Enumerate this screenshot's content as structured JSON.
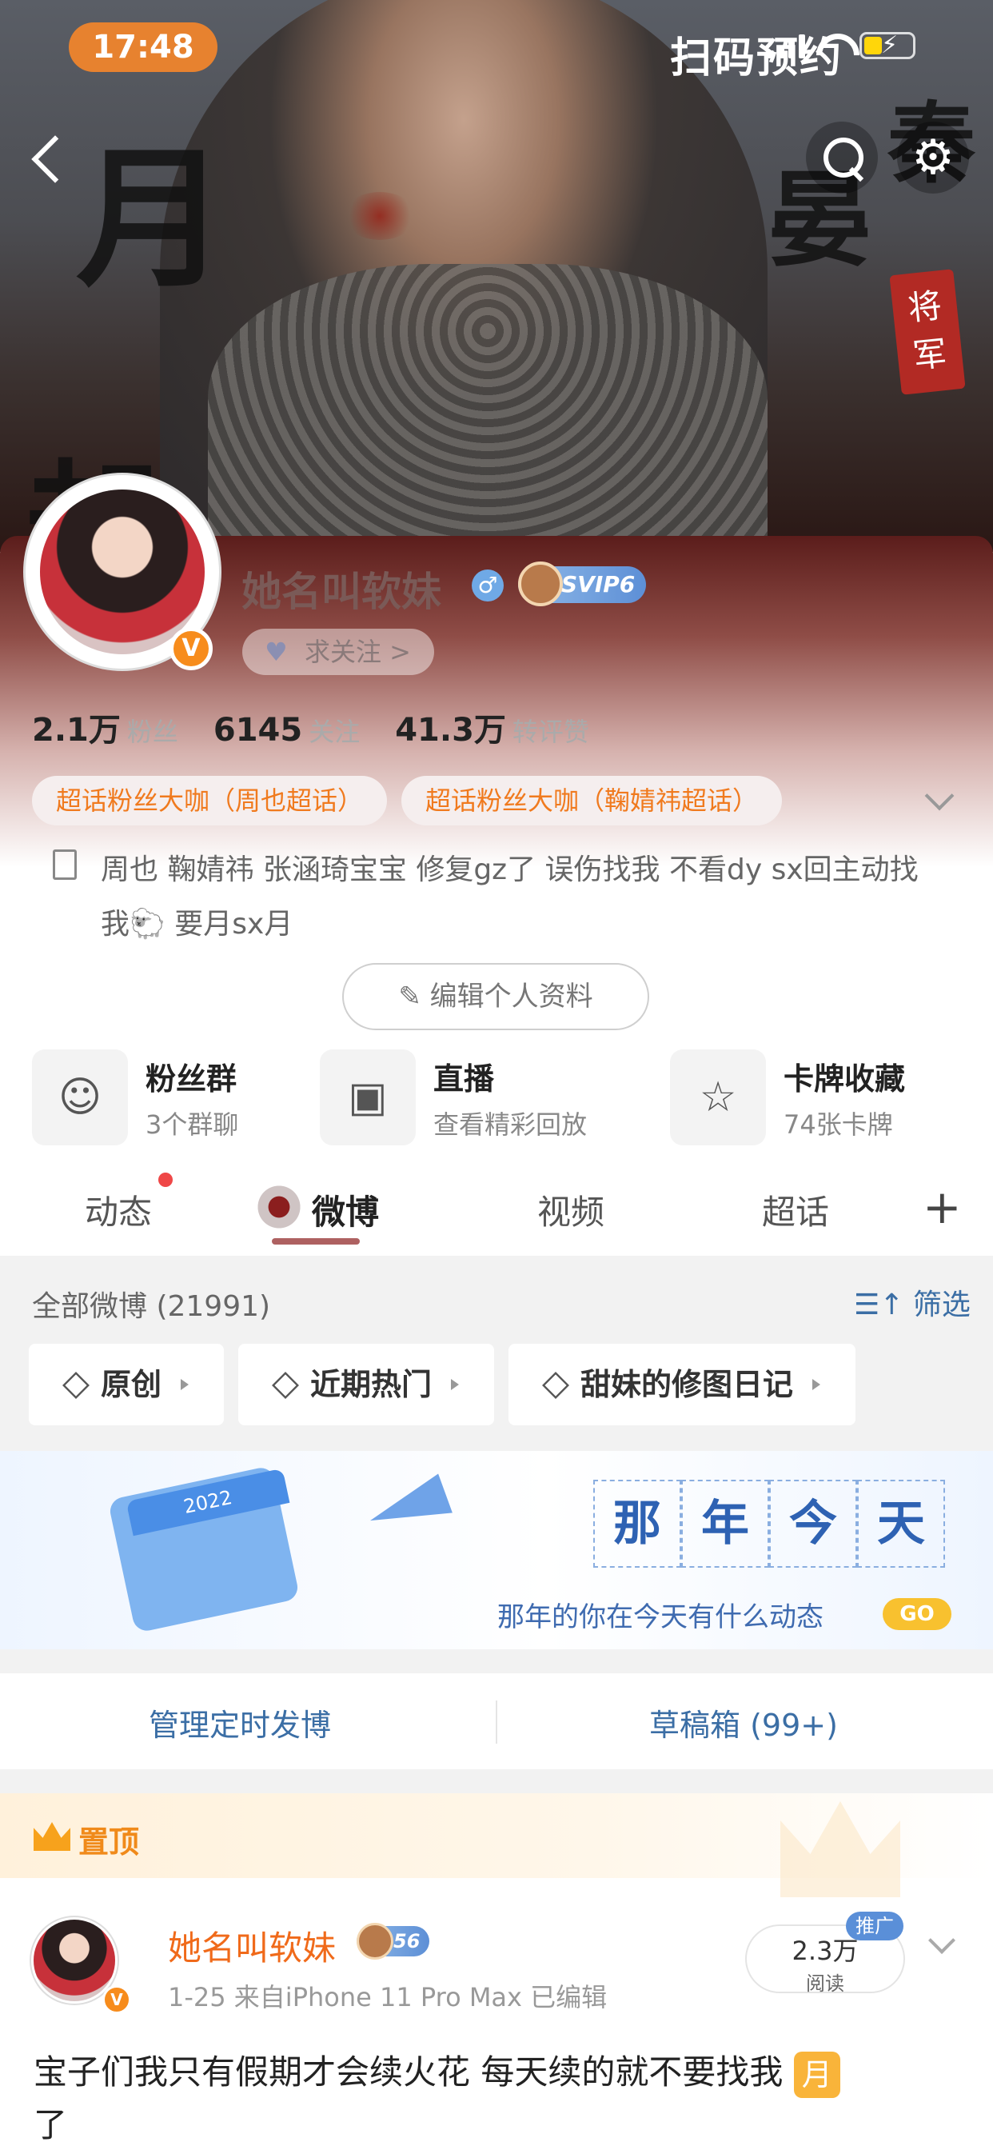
{
  "status_bar": {
    "time": "17:48"
  },
  "hero": {
    "scan_text": "扫码预约",
    "calligraphy": [
      "月",
      "秦",
      "晏",
      "却"
    ],
    "seal_text": "将军"
  },
  "profile": {
    "username": "她名叫软妹",
    "gender_symbol": "♂",
    "svip_label": "SVIP6",
    "verified_badge": "V",
    "follow_label": "求关注 >",
    "stats": [
      {
        "value": "2.1万",
        "label": "粉丝"
      },
      {
        "value": "6145",
        "label": "关注"
      },
      {
        "value": "41.3万",
        "label": "转评赞"
      }
    ],
    "tags": [
      "超话粉丝大咖（周也超话）",
      "超话粉丝大咖（鞠婧祎超话）"
    ],
    "bio": "周也 鞠婧祎 张涵琦宝宝 修复gz了 误伤找我 不看dy sx回主动找我🐑 要月sx月",
    "edit_label": "✎ 编辑个人资料"
  },
  "quick_links": [
    {
      "icon": "fans-group-icon",
      "title": "粉丝群",
      "sub": "3个群聊"
    },
    {
      "icon": "live-icon",
      "title": "直播",
      "sub": "查看精彩回放"
    },
    {
      "icon": "card-icon",
      "title": "卡牌收藏",
      "sub": "74张卡牌"
    }
  ],
  "tabs": [
    "动态",
    "微博",
    "视频",
    "超话"
  ],
  "active_tab": "微博",
  "filter": {
    "count_label": "全部微博 (21991)",
    "filter_label": "筛选",
    "chips": [
      "原创",
      "近期热门",
      "甜妹的修图日记"
    ]
  },
  "banner": {
    "calendar_year": "2022",
    "title_chars": [
      "那",
      "年",
      "今",
      "天"
    ],
    "subtitle": "那年的你在今天有什么动态",
    "go_label": "GO"
  },
  "manage": {
    "scheduled": "管理定时发博",
    "drafts": "草稿箱 (99+)"
  },
  "post": {
    "pin_label": "置顶",
    "author": "她名叫软妹",
    "level_label": "56",
    "meta": "1-25  来自iPhone 11 Pro Max  已编辑",
    "reads_value": "2.3万",
    "reads_label": "阅读",
    "promo_label": "推广",
    "text": "宝子们我只有假期才会续火花 每天续的就不要找我",
    "moon_emoji": "月",
    "text_tail": "了"
  },
  "colors": {
    "accent_orange": "#f07a1e",
    "link_blue": "#3b6ea5",
    "time_pill": "#e7822f"
  }
}
